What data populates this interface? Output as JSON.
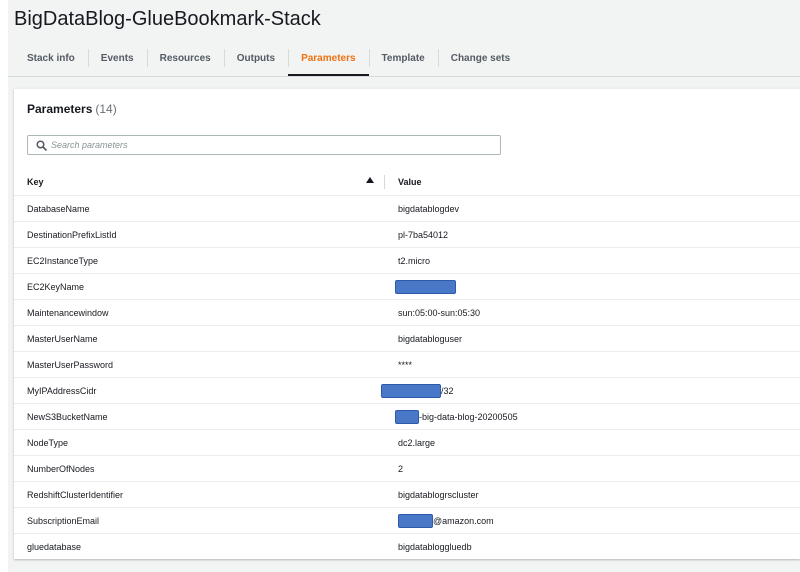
{
  "stack": {
    "title": "BigDataBlog-GlueBookmark-Stack"
  },
  "tabs": [
    {
      "label": "Stack info"
    },
    {
      "label": "Events"
    },
    {
      "label": "Resources"
    },
    {
      "label": "Outputs"
    },
    {
      "label": "Parameters",
      "active": true
    },
    {
      "label": "Template"
    },
    {
      "label": "Change sets"
    }
  ],
  "parameters": {
    "heading": "Parameters",
    "count": "(14)",
    "search_placeholder": "Search parameters",
    "search_icon": "search-icon",
    "sort_icon": "sort-ascending-icon",
    "columns": {
      "key": "Key",
      "value": "Value"
    },
    "rows": [
      {
        "key": "DatabaseName",
        "value": "bigdatablogdev"
      },
      {
        "key": "DestinationPrefixListId",
        "value": "pl-7ba54012"
      },
      {
        "key": "EC2InstanceType",
        "value": "t2.micro"
      },
      {
        "key": "EC2KeyName",
        "value": ""
      },
      {
        "key": "Maintenancewindow",
        "value": "sun:05:00-sun:05:30"
      },
      {
        "key": "MasterUserName",
        "value": "bigdatabloguser"
      },
      {
        "key": "MasterUserPassword",
        "value": "****"
      },
      {
        "key": "MyIPAddressCidr",
        "value": "/32"
      },
      {
        "key": "NewS3BucketName",
        "value": "-big-data-blog-20200505"
      },
      {
        "key": "NodeType",
        "value": "dc2.large"
      },
      {
        "key": "NumberOfNodes",
        "value": "2"
      },
      {
        "key": "RedshiftClusterIdentifier",
        "value": "bigdatablogrscluster"
      },
      {
        "key": "SubscriptionEmail",
        "value": "@amazon.com"
      },
      {
        "key": "gluedatabase",
        "value": "bigdatabloggluedb"
      }
    ]
  },
  "colors": {
    "active_tab": "#ec7211",
    "redaction": "#4a78c8"
  }
}
